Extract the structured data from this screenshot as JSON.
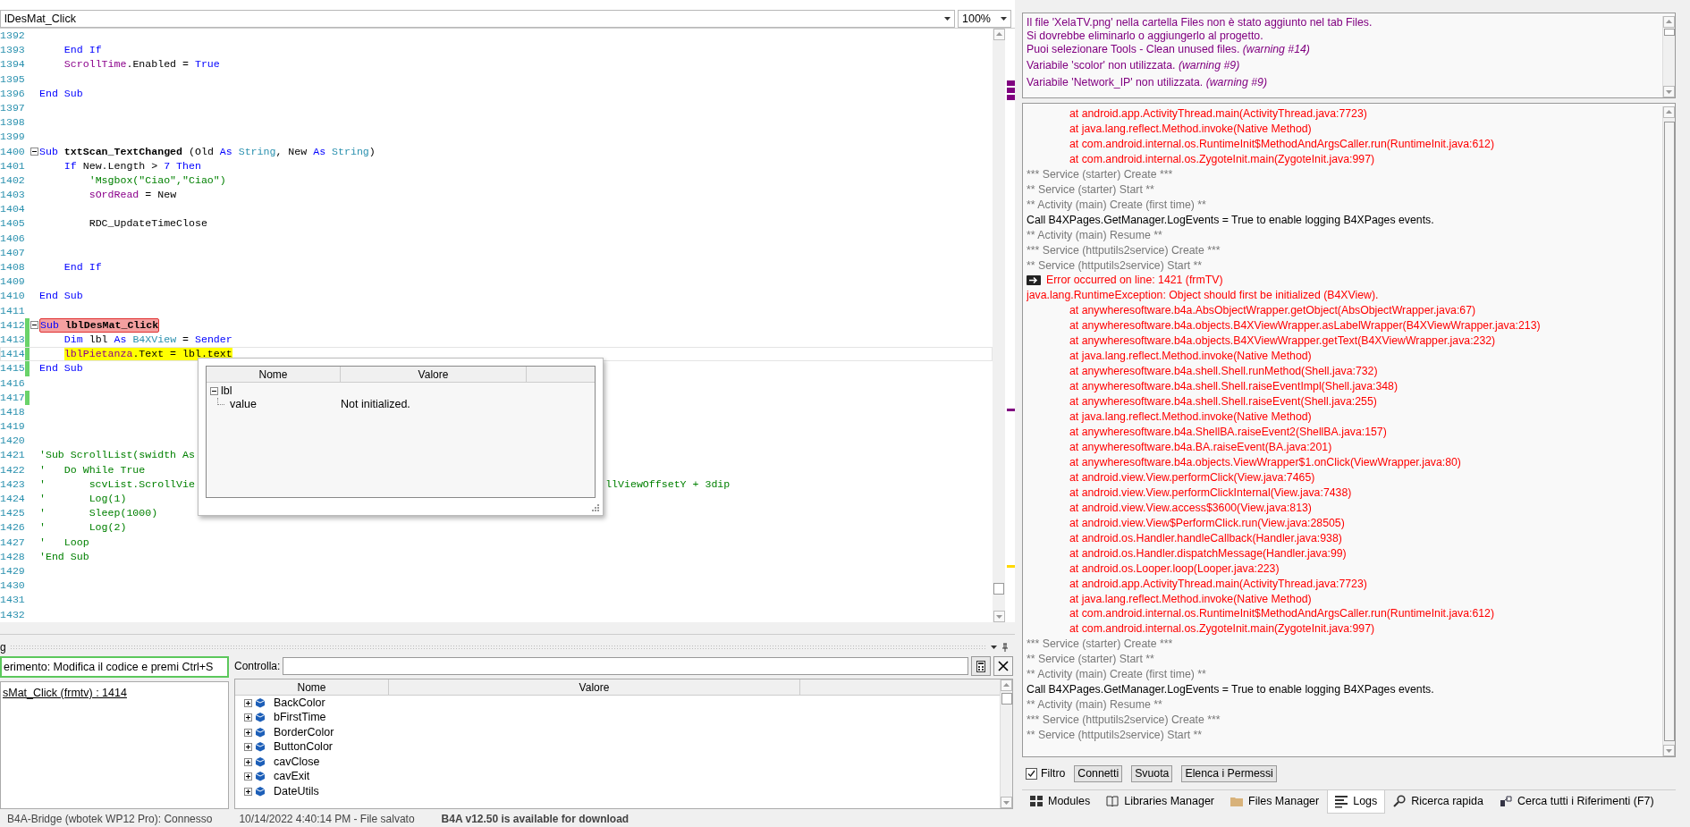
{
  "editor": {
    "sub_selector": "lDesMat_Click",
    "zoom": "100%",
    "lines": [
      {
        "number": "1392",
        "changed": false,
        "error": false,
        "current": false,
        "fold": false
      },
      {
        "number": "1393",
        "changed": false,
        "error": false,
        "current": false,
        "fold": false,
        "tokens": [
          {
            "kind": "keyword",
            "text": "    End If"
          }
        ]
      },
      {
        "number": "1394",
        "changed": false,
        "error": false,
        "current": false,
        "fold": false,
        "tokens": [
          {
            "kind": "variable",
            "text": "    ScrollTime"
          },
          {
            "kind": "plain",
            "text": ".Enabled = "
          },
          {
            "kind": "keyword",
            "text": "True"
          }
        ]
      },
      {
        "number": "1395",
        "changed": false,
        "error": false,
        "current": false,
        "fold": false
      },
      {
        "number": "1396",
        "changed": false,
        "error": false,
        "current": false,
        "fold": false,
        "tokens": [
          {
            "kind": "keyword",
            "text": "End Sub"
          }
        ]
      },
      {
        "number": "1397",
        "changed": false,
        "error": false,
        "current": false,
        "fold": false
      },
      {
        "number": "1398",
        "changed": false,
        "error": false,
        "current": false,
        "fold": false
      },
      {
        "number": "1399",
        "changed": false,
        "error": false,
        "current": false,
        "fold": false
      },
      {
        "number": "1400",
        "changed": false,
        "error": false,
        "current": false,
        "fold": true,
        "tokens": [
          {
            "kind": "keyword",
            "text": "Sub "
          },
          {
            "kind": "name",
            "text": "txtScan_TextChanged"
          },
          {
            "kind": "plain",
            "text": " (Old "
          },
          {
            "kind": "keyword",
            "text": "As "
          },
          {
            "kind": "type",
            "text": "String"
          },
          {
            "kind": "plain",
            "text": ", New "
          },
          {
            "kind": "keyword",
            "text": "As "
          },
          {
            "kind": "type",
            "text": "String"
          },
          {
            "kind": "plain",
            "text": ")"
          }
        ]
      },
      {
        "number": "1401",
        "changed": false,
        "error": false,
        "current": false,
        "fold": false,
        "tokens": [
          {
            "kind": "keyword",
            "text": "    If "
          },
          {
            "kind": "plain",
            "text": "New.Length > "
          },
          {
            "kind": "keyword",
            "text": "7 Then"
          }
        ]
      },
      {
        "number": "1402",
        "changed": false,
        "error": false,
        "current": false,
        "fold": false,
        "tokens": [
          {
            "kind": "comment",
            "text": "        'Msgbox(\"Ciao\",\"Ciao\")"
          }
        ]
      },
      {
        "number": "1403",
        "changed": false,
        "error": false,
        "current": false,
        "fold": false,
        "tokens": [
          {
            "kind": "variable",
            "text": "        sOrdRead"
          },
          {
            "kind": "plain",
            "text": " = New"
          }
        ]
      },
      {
        "number": "1404",
        "changed": false,
        "error": false,
        "current": false,
        "fold": false
      },
      {
        "number": "1405",
        "changed": false,
        "error": false,
        "current": false,
        "fold": false,
        "tokens": [
          {
            "kind": "plain",
            "text": "        RDC_UpdateTimeClose"
          }
        ]
      },
      {
        "number": "1406",
        "changed": false,
        "error": false,
        "current": false,
        "fold": false
      },
      {
        "number": "1407",
        "changed": false,
        "error": false,
        "current": false,
        "fold": false
      },
      {
        "number": "1408",
        "changed": false,
        "error": false,
        "current": false,
        "fold": false,
        "tokens": [
          {
            "kind": "keyword",
            "text": "    End If"
          }
        ]
      },
      {
        "number": "1409",
        "changed": false,
        "error": false,
        "current": false,
        "fold": false
      },
      {
        "number": "1410",
        "changed": false,
        "error": false,
        "current": false,
        "fold": false,
        "tokens": [
          {
            "kind": "keyword",
            "text": "End Sub"
          }
        ]
      },
      {
        "number": "1411",
        "changed": false,
        "error": false,
        "current": false,
        "fold": false
      },
      {
        "number": "1412",
        "changed": true,
        "error": true,
        "current": false,
        "fold": true,
        "tokens": [
          {
            "kind": "keyword",
            "text": "Sub "
          },
          {
            "kind": "name",
            "text": "lblDesMat_Click"
          }
        ]
      },
      {
        "number": "1413",
        "changed": true,
        "error": false,
        "current": false,
        "fold": false,
        "tokens": [
          {
            "kind": "keyword",
            "text": "    Dim "
          },
          {
            "kind": "plain",
            "text": "lbl "
          },
          {
            "kind": "keyword",
            "text": "As "
          },
          {
            "kind": "type",
            "text": "B4XView"
          },
          {
            "kind": "plain",
            "text": " = "
          },
          {
            "kind": "keyword",
            "text": "Sender"
          }
        ]
      },
      {
        "number": "1414",
        "changed": true,
        "error": false,
        "current": true,
        "fold": false,
        "tokens": [
          {
            "kind": "variable",
            "text": "    lblPietanza"
          },
          {
            "kind": "plain",
            "text": ".Text = lbl.text"
          }
        ]
      },
      {
        "number": "1415",
        "changed": true,
        "error": false,
        "current": false,
        "fold": false,
        "tokens": [
          {
            "kind": "keyword",
            "text": "End Sub"
          }
        ]
      },
      {
        "number": "1416",
        "changed": false,
        "error": false,
        "current": false,
        "fold": false
      },
      {
        "number": "1417",
        "changed": true,
        "error": false,
        "current": false,
        "fold": false
      },
      {
        "number": "1418",
        "changed": false,
        "error": false,
        "current": false,
        "fold": false
      },
      {
        "number": "1419",
        "changed": false,
        "error": false,
        "current": false,
        "fold": false
      },
      {
        "number": "1420",
        "changed": false,
        "error": false,
        "current": false,
        "fold": false
      },
      {
        "number": "1421",
        "changed": false,
        "error": false,
        "current": false,
        "fold": false,
        "tokens": [
          {
            "kind": "comment",
            "text": "'Sub ScrollList(swidth As"
          }
        ]
      },
      {
        "number": "1422",
        "changed": false,
        "error": false,
        "current": false,
        "fold": false,
        "tokens": [
          {
            "kind": "comment",
            "text": "'   Do While True"
          }
        ]
      },
      {
        "number": "1423",
        "changed": false,
        "error": false,
        "current": false,
        "fold": false,
        "tokens": [
          {
            "kind": "comment",
            "text": "'       scvList.ScrollVie"
          },
          {
            "kind": "comment",
            "text": "                                                                  llViewOffsetY + 3dip"
          }
        ]
      },
      {
        "number": "1424",
        "changed": false,
        "error": false,
        "current": false,
        "fold": false,
        "tokens": [
          {
            "kind": "comment",
            "text": "'       Log(1)"
          }
        ]
      },
      {
        "number": "1425",
        "changed": false,
        "error": false,
        "current": false,
        "fold": false,
        "tokens": [
          {
            "kind": "comment",
            "text": "'       Sleep(1000)"
          }
        ]
      },
      {
        "number": "1426",
        "changed": false,
        "error": false,
        "current": false,
        "fold": false,
        "tokens": [
          {
            "kind": "comment",
            "text": "'       Log(2)"
          }
        ]
      },
      {
        "number": "1427",
        "changed": false,
        "error": false,
        "current": false,
        "fold": false,
        "tokens": [
          {
            "kind": "comment",
            "text": "'   Loop"
          }
        ]
      },
      {
        "number": "1428",
        "changed": false,
        "error": false,
        "current": false,
        "fold": false,
        "tokens": [
          {
            "kind": "comment",
            "text": "'End Sub"
          }
        ]
      },
      {
        "number": "1429",
        "changed": false,
        "error": false,
        "current": false,
        "fold": false
      },
      {
        "number": "1430",
        "changed": false,
        "error": false,
        "current": false,
        "fold": false
      },
      {
        "number": "1431",
        "changed": false,
        "error": false,
        "current": false,
        "fold": false
      },
      {
        "number": "1432",
        "changed": false,
        "error": false,
        "current": false,
        "fold": false
      }
    ]
  },
  "watch_popup": {
    "columns": [
      "Nome",
      "Valore"
    ],
    "rows": [
      {
        "name": "lbl",
        "expanded": true,
        "children": [
          {
            "name": "value",
            "value": "Not initialized."
          }
        ]
      }
    ]
  },
  "debug_panel": {
    "title": "g",
    "hint": "erimento: Modifica il codice e premi Ctrl+S",
    "stack": [
      "sMat_Click (frmtv) : 1414"
    ],
    "watch_label": "Controlla:",
    "grid": {
      "columns": [
        "Nome",
        "Valore"
      ],
      "rows": [
        {
          "name": "BackColor",
          "expanded": false
        },
        {
          "name": "bFirstTime",
          "expanded": false
        },
        {
          "name": "BorderColor",
          "expanded": false
        },
        {
          "name": "ButtonColor",
          "expanded": false
        },
        {
          "name": "cavClose",
          "expanded": false
        },
        {
          "name": "cavExit",
          "expanded": false
        },
        {
          "name": "DateUtils",
          "expanded": false
        }
      ]
    }
  },
  "status_bar": [
    "B4A-Bridge (wbotek WP12 Pro): Connesso",
    "10/14/2022 4:40:14 PM - File salvato",
    "B4A v12.50 is available for download"
  ],
  "warnings": [
    {
      "lines": [
        "Il file 'XelaTV.png' nella cartella Files non è stato aggiunto nel tab Files.",
        "Si dovrebbe eliminarlo o aggiungerlo al progetto.",
        "Puoi selezionare Tools - Clean unused files. *(warning #14)*"
      ]
    },
    {
      "lines": [
        "Variabile 'scolor' non utilizzata. *(warning #9)*"
      ]
    },
    {
      "lines": [
        "Variabile 'Network_IP' non utilizzata. *(warning #9)*"
      ]
    }
  ],
  "logs": [
    {
      "kind": "trace",
      "text": "at android.app.ActivityThread.main(ActivityThread.java:7723)"
    },
    {
      "kind": "trace",
      "text": "at java.lang.reflect.Method.invoke(Native Method)"
    },
    {
      "kind": "trace",
      "text": "at com.android.internal.os.RuntimeInit$MethodAndArgsCaller.run(RuntimeInit.java:612)"
    },
    {
      "kind": "trace",
      "text": "at com.android.internal.os.ZygoteInit.main(ZygoteInit.java:997)"
    },
    {
      "kind": "system",
      "text": "*** Service (starter) Create ***"
    },
    {
      "kind": "system",
      "text": "** Service (starter) Start **"
    },
    {
      "kind": "system",
      "text": "** Activity (main) Create (first time) **"
    },
    {
      "kind": "plain",
      "text": "Call B4XPages.GetManager.LogEvents = True to enable logging B4XPages events."
    },
    {
      "kind": "system",
      "text": "** Activity (main) Resume **"
    },
    {
      "kind": "system",
      "text": "*** Service (httputils2service) Create ***"
    },
    {
      "kind": "system",
      "text": "** Service (httputils2service) Start **"
    },
    {
      "kind": "error_line",
      "text": "Error occurred on line: 1421 (frmTV)"
    },
    {
      "kind": "exception",
      "text": "java.lang.RuntimeException: Object should first be initialized (B4XView)."
    },
    {
      "kind": "trace",
      "text": "at anywheresoftware.b4a.AbsObjectWrapper.getObject(AbsObjectWrapper.java:67)"
    },
    {
      "kind": "trace",
      "text": "at anywheresoftware.b4a.objects.B4XViewWrapper.asLabelWrapper(B4XViewWrapper.java:213)"
    },
    {
      "kind": "trace",
      "text": "at anywheresoftware.b4a.objects.B4XViewWrapper.getText(B4XViewWrapper.java:232)"
    },
    {
      "kind": "trace",
      "text": "at java.lang.reflect.Method.invoke(Native Method)"
    },
    {
      "kind": "trace",
      "text": "at anywheresoftware.b4a.shell.Shell.runMethod(Shell.java:732)"
    },
    {
      "kind": "trace",
      "text": "at anywheresoftware.b4a.shell.Shell.raiseEventImpl(Shell.java:348)"
    },
    {
      "kind": "trace",
      "text": "at anywheresoftware.b4a.shell.Shell.raiseEvent(Shell.java:255)"
    },
    {
      "kind": "trace",
      "text": "at java.lang.reflect.Method.invoke(Native Method)"
    },
    {
      "kind": "trace",
      "text": "at anywheresoftware.b4a.ShellBA.raiseEvent2(ShellBA.java:157)"
    },
    {
      "kind": "trace",
      "text": "at anywheresoftware.b4a.BA.raiseEvent(BA.java:201)"
    },
    {
      "kind": "trace",
      "text": "at anywheresoftware.b4a.objects.ViewWrapper$1.onClick(ViewWrapper.java:80)"
    },
    {
      "kind": "trace",
      "text": "at android.view.View.performClick(View.java:7465)"
    },
    {
      "kind": "trace",
      "text": "at android.view.View.performClickInternal(View.java:7438)"
    },
    {
      "kind": "trace",
      "text": "at android.view.View.access$3600(View.java:813)"
    },
    {
      "kind": "trace",
      "text": "at android.view.View$PerformClick.run(View.java:28505)"
    },
    {
      "kind": "trace",
      "text": "at android.os.Handler.handleCallback(Handler.java:938)"
    },
    {
      "kind": "trace",
      "text": "at android.os.Handler.dispatchMessage(Handler.java:99)"
    },
    {
      "kind": "trace",
      "text": "at android.os.Looper.loop(Looper.java:223)"
    },
    {
      "kind": "trace",
      "text": "at android.app.ActivityThread.main(ActivityThread.java:7723)"
    },
    {
      "kind": "trace",
      "text": "at java.lang.reflect.Method.invoke(Native Method)"
    },
    {
      "kind": "trace",
      "text": "at com.android.internal.os.RuntimeInit$MethodAndArgsCaller.run(RuntimeInit.java:612)"
    },
    {
      "kind": "trace",
      "text": "at com.android.internal.os.ZygoteInit.main(ZygoteInit.java:997)"
    },
    {
      "kind": "system",
      "text": "*** Service (starter) Create ***"
    },
    {
      "kind": "system",
      "text": "** Service (starter) Start **"
    },
    {
      "kind": "system",
      "text": "** Activity (main) Create (first time) **"
    },
    {
      "kind": "plain",
      "text": "Call B4XPages.GetManager.LogEvents = True to enable logging B4XPages events."
    },
    {
      "kind": "system",
      "text": "** Activity (main) Resume **"
    },
    {
      "kind": "system",
      "text": "*** Service (httputils2service) Create ***"
    },
    {
      "kind": "system",
      "text": "** Service (httputils2service) Start **"
    }
  ],
  "log_controls": {
    "filter": {
      "label": "Filtro",
      "checked": true
    },
    "buttons": [
      "Connetti",
      "Svuota",
      "Elenca i Permessi"
    ]
  },
  "tabs": [
    {
      "label": "Modules",
      "selected": false
    },
    {
      "label": "Libraries Manager",
      "selected": false
    },
    {
      "label": "Files Manager",
      "selected": false
    },
    {
      "label": "Logs",
      "selected": true
    },
    {
      "label": "Ricerca rapida",
      "selected": false
    },
    {
      "label": "Cerca tutti i Riferimenti (F7)",
      "selected": false
    }
  ]
}
